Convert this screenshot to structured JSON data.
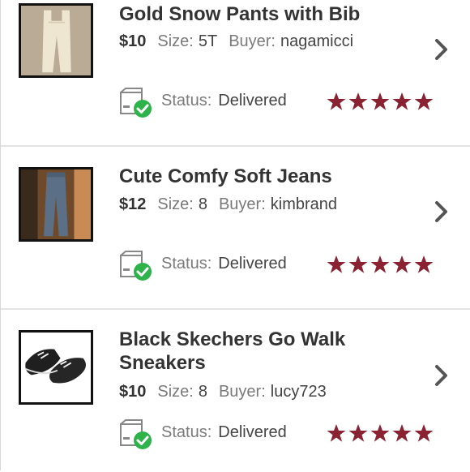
{
  "colors": {
    "star": "#8b2231",
    "check_badge": "#2db34a",
    "divider": "#e3e3e3"
  },
  "labels": {
    "size": "Size:",
    "buyer": "Buyer:",
    "status": "Status:"
  },
  "icons": {
    "chevron": "chevron-right-icon",
    "status": "package-delivered-icon",
    "star": "star-icon"
  },
  "items": [
    {
      "title": "Gold Snow Pants with Bib",
      "price": "$10",
      "size": "5T",
      "buyer": "nagamicci",
      "status": "Delivered",
      "rating": 5
    },
    {
      "title": "Cute Comfy Soft Jeans",
      "price": "$12",
      "size": "8",
      "buyer": "kimbrand",
      "status": "Delivered",
      "rating": 5
    },
    {
      "title": "Black Skechers Go Walk Sneakers",
      "price": "$10",
      "size": "8",
      "buyer": "lucy723",
      "status": "Delivered",
      "rating": 5
    }
  ]
}
